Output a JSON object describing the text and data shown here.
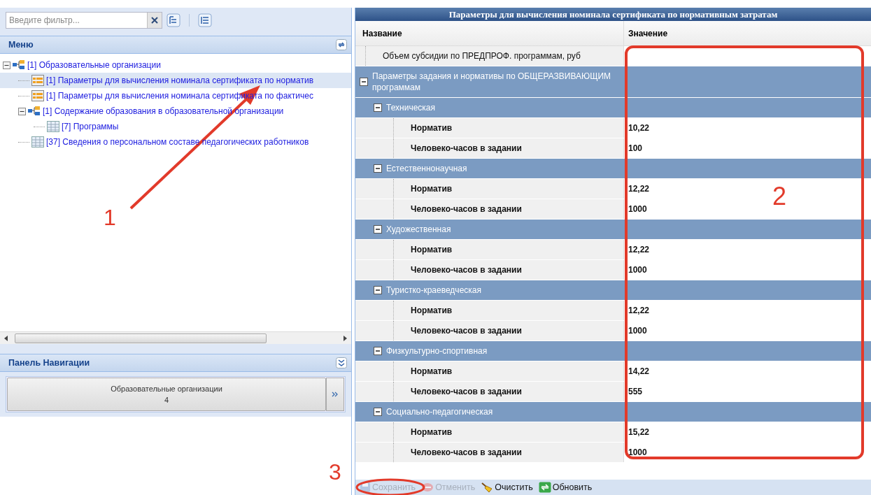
{
  "filter": {
    "placeholder": "Введите фильтр..."
  },
  "menu": {
    "title": "Меню",
    "items": [
      {
        "label": "[1] Образовательные организации",
        "kind": "folder",
        "expanded": true,
        "selected": false,
        "children": [
          {
            "label": "[1] Параметры для вычисления номинала сертификата по норматив",
            "kind": "form",
            "selected": true
          },
          {
            "label": "[1] Параметры для вычисления номинала сертификата по фактичес",
            "kind": "form",
            "selected": false
          },
          {
            "label": "[1] Содержание образования в образовательной организации",
            "kind": "folder",
            "expanded": true,
            "selected": false,
            "children": [
              {
                "label": "[7] Программы",
                "kind": "table",
                "selected": false
              }
            ]
          },
          {
            "label": "[37] Сведения о персональном составе педагогических работников",
            "kind": "table",
            "selected": false
          }
        ]
      }
    ]
  },
  "nav_panel": {
    "title": "Панель Навигации",
    "button": {
      "label": "Образовательные организации",
      "count": "4"
    }
  },
  "grid": {
    "title": "Параметры для вычисления номинала сертификата по нормативным затратам",
    "columns": [
      "Название",
      "Значение"
    ],
    "rows": [
      {
        "kind": "param",
        "name": "Объем субсидии по ПРЕДПРОФ. программам, руб",
        "value": ""
      },
      {
        "kind": "group",
        "name": "Параметры задания и нормативы по ОБЩЕРАЗВИВАЮЩИМ программам",
        "expanded": true,
        "children": [
          {
            "kind": "group",
            "name": "Техническая",
            "expanded": true,
            "children": [
              {
                "kind": "param",
                "name": "Норматив",
                "value": "10,22"
              },
              {
                "kind": "param",
                "name": "Человеко-часов в задании",
                "value": "100"
              }
            ]
          },
          {
            "kind": "group",
            "name": "Естественнонаучная",
            "expanded": true,
            "children": [
              {
                "kind": "param",
                "name": "Норматив",
                "value": "12,22"
              },
              {
                "kind": "param",
                "name": "Человеко-часов в задании",
                "value": "1000"
              }
            ]
          },
          {
            "kind": "group",
            "name": "Художественная",
            "expanded": true,
            "children": [
              {
                "kind": "param",
                "name": "Норматив",
                "value": "12,22"
              },
              {
                "kind": "param",
                "name": "Человеко-часов в задании",
                "value": "1000"
              }
            ]
          },
          {
            "kind": "group",
            "name": "Туристко-краеведческая",
            "expanded": true,
            "children": [
              {
                "kind": "param",
                "name": "Норматив",
                "value": "12,22"
              },
              {
                "kind": "param",
                "name": "Человеко-часов в задании",
                "value": "1000"
              }
            ]
          },
          {
            "kind": "group",
            "name": "Физкультурно-спортивная",
            "expanded": true,
            "children": [
              {
                "kind": "param",
                "name": "Норматив",
                "value": "14,22"
              },
              {
                "kind": "param",
                "name": "Человеко-часов в задании",
                "value": "555"
              }
            ]
          },
          {
            "kind": "group",
            "name": "Социально-педагогическая",
            "expanded": true,
            "children": [
              {
                "kind": "param",
                "name": "Норматив",
                "value": "15,22"
              },
              {
                "kind": "param",
                "name": "Человеко-часов в задании",
                "value": "1000"
              }
            ]
          }
        ]
      }
    ]
  },
  "toolbar": [
    {
      "label": "Сохранить",
      "kind": "save",
      "disabled": true
    },
    {
      "label": "Отменить",
      "kind": "cancel",
      "disabled": true
    },
    {
      "label": "Очистить",
      "kind": "clear",
      "disabled": false
    },
    {
      "label": "Обновить",
      "kind": "refresh",
      "disabled": false
    }
  ],
  "annotations": [
    {
      "label": "1"
    },
    {
      "label": "2"
    },
    {
      "label": "3"
    }
  ]
}
